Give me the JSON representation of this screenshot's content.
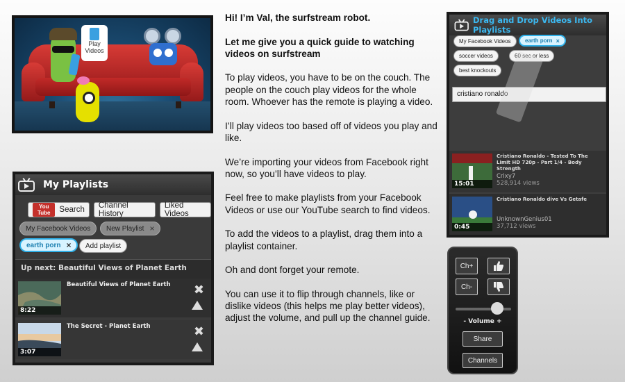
{
  "guide": {
    "greeting": "Hi! I’m Val, the surfstream robot.",
    "intro": "Let  me give you a quick guide to watching videos on surfstream",
    "paragraphs": [
      "To play videos, you have to be on the couch. The people on the couch play videos for the whole room. Whoever has the remote is playing a video.",
      "I’ll play videos too based off of videos you play and like.",
      "We’re importing your videos from Facebook right now, so you’ll have videos to play.",
      "Feel free to make playlists from your Facebook Videos or use our YouTube search to find videos.",
      "To add the videos to a playlist, drag them into a playlist container.",
      "Oh and dont forget your remote.",
      "You can use it to flip through channels, like or dislike videos (this helps me play better videos), adjust the volume, and pull up the channel guide."
    ]
  },
  "scene": {
    "bubble_text": "Play Videos"
  },
  "playlists": {
    "title": "My Playlists",
    "youtube_logo": "You Tube",
    "tabs": [
      "Search",
      "Channel History",
      "Liked Videos"
    ],
    "pills": {
      "facebook": "My Facebook Videos",
      "new_playlist": "New Playlist",
      "earthporn": "earth porn",
      "add_playlist": "Add playlist"
    },
    "close_glyph": "×",
    "up_next": "Up next: Beautiful Views of Planet Earth",
    "videos": [
      {
        "title": "Beautiful Views of Planet Earth",
        "duration": "8:22"
      },
      {
        "title": "The Secret - Planet Earth",
        "duration": "3:07"
      }
    ],
    "remove_glyph": "✖"
  },
  "drag_panel": {
    "title": "Drag and Drop Videos Into Playlists",
    "pills": {
      "facebook": "My Facebook Videos",
      "earthporn": "earth porn",
      "soccer": "soccer videos",
      "sixtysec": "60 sec or less",
      "knockouts": "best knockouts"
    },
    "close_glyph": "×",
    "search_value": "cristiano ronaldo",
    "results": [
      {
        "title": "Cristiano Ronaldo - Tested To The Limit HD 720p - Part 1/4 - Body Strength",
        "author": "Crixy7",
        "views": "528,914 views",
        "duration": "15:01"
      },
      {
        "title": "Cristiano Ronaldo dive Vs Getafe",
        "author": "UnknownGenius01",
        "views": "37,712 views",
        "duration": "0:45"
      }
    ]
  },
  "remote": {
    "ch_up": "Ch+",
    "ch_down": "Ch-",
    "volume_label": "- Volume +",
    "volume_level": 0.75,
    "share": "Share",
    "channels": "Channels"
  }
}
